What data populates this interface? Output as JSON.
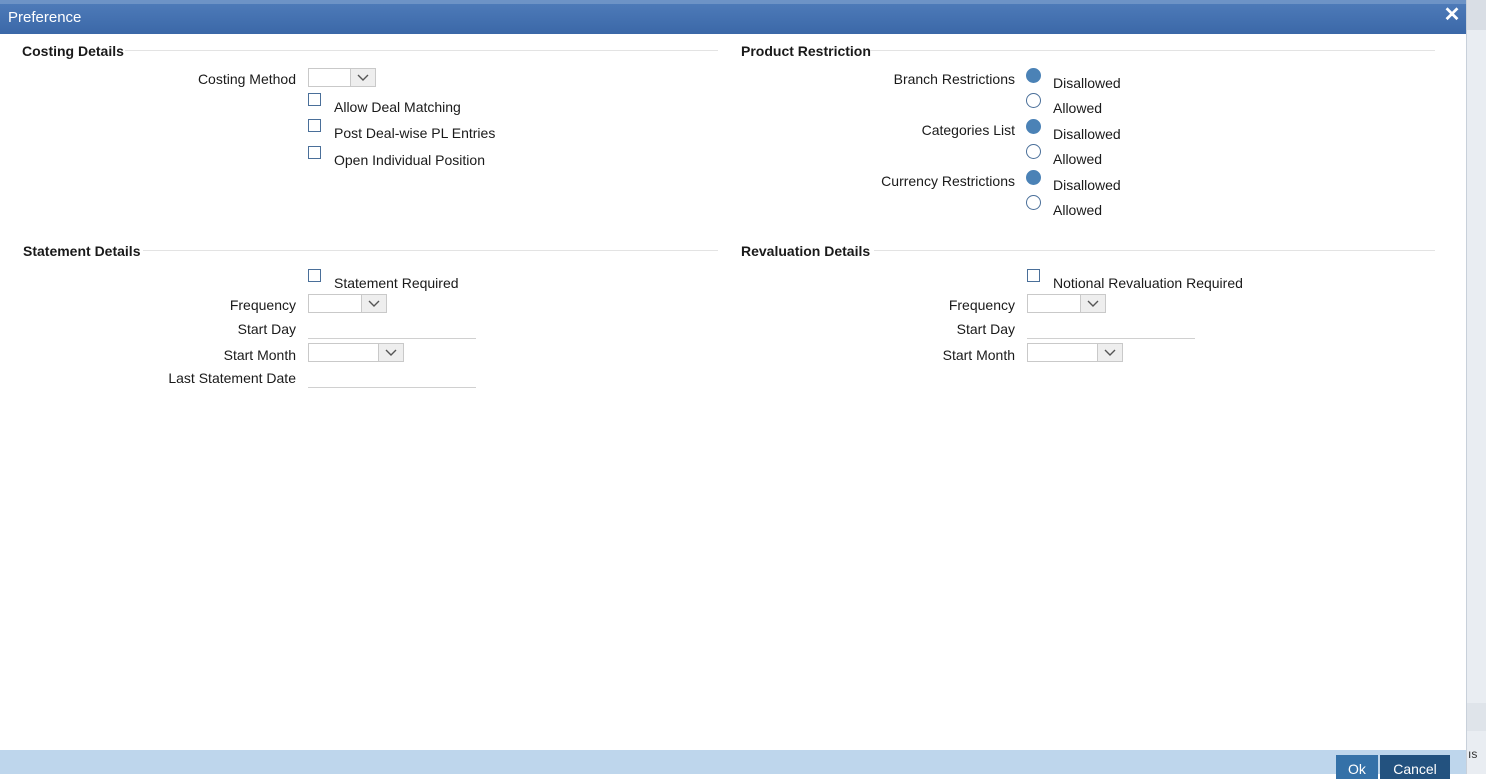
{
  "window": {
    "title": "Preference"
  },
  "costing": {
    "title": "Costing Details",
    "method_label": "Costing Method",
    "method_value": "",
    "allow_deal_matching": "Allow Deal Matching",
    "post_deal_wise": "Post Deal-wise PL Entries",
    "open_individual": "Open Individual Position"
  },
  "product": {
    "title": "Product Restriction",
    "branch_label": "Branch Restrictions",
    "categories_label": "Categories List",
    "currency_label": "Currency Restrictions",
    "disallowed": "Disallowed",
    "allowed": "Allowed"
  },
  "statement": {
    "title": "Statement Details",
    "required_label": "Statement Required",
    "frequency_label": "Frequency",
    "start_day_label": "Start Day",
    "start_month_label": "Start Month",
    "last_date_label": "Last Statement Date"
  },
  "revaluation": {
    "title": "Revaluation Details",
    "required_label": "Notional Revaluation Required",
    "frequency_label": "Frequency",
    "start_day_label": "Start Day",
    "start_month_label": "Start Month"
  },
  "footer": {
    "ok": "Ok",
    "cancel": "Cancel"
  },
  "background": {
    "partial_text": "ıs"
  },
  "colors": {
    "titlebar": "#3b68a8",
    "footer": "#bed6ec",
    "button": "#23527f",
    "radio_on": "#4b82b6"
  }
}
